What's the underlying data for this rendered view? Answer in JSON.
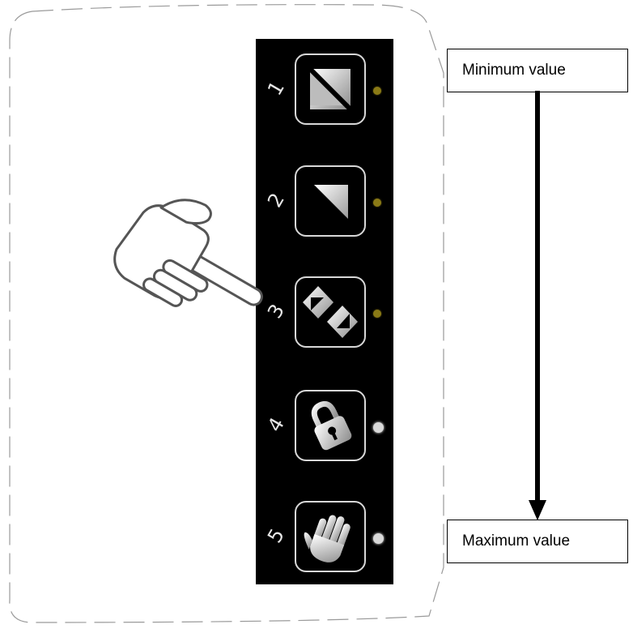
{
  "panel": {
    "modes": [
      {
        "number": "1",
        "icon": "diagonal-split-square-icon",
        "indicator": "off"
      },
      {
        "number": "2",
        "icon": "triangle-corner-icon",
        "indicator": "off"
      },
      {
        "number": "3",
        "icon": "bidirectional-triangles-icon",
        "indicator": "off"
      },
      {
        "number": "4",
        "icon": "padlock-icon",
        "indicator": "on"
      },
      {
        "number": "5",
        "icon": "hand-icon",
        "indicator": "on"
      }
    ],
    "pointer_icon": "pointing-hand-icon",
    "pointer_target_mode": "3"
  },
  "scale": {
    "min_label": "Minimum value",
    "max_label": "Maximum value",
    "arrow_icon": "down-arrow-icon"
  },
  "colors": {
    "panel_background": "#000000",
    "button_border": "#d8d8d8",
    "indicator_off": "#8a7a16",
    "indicator_on": "#d9d9d9"
  }
}
